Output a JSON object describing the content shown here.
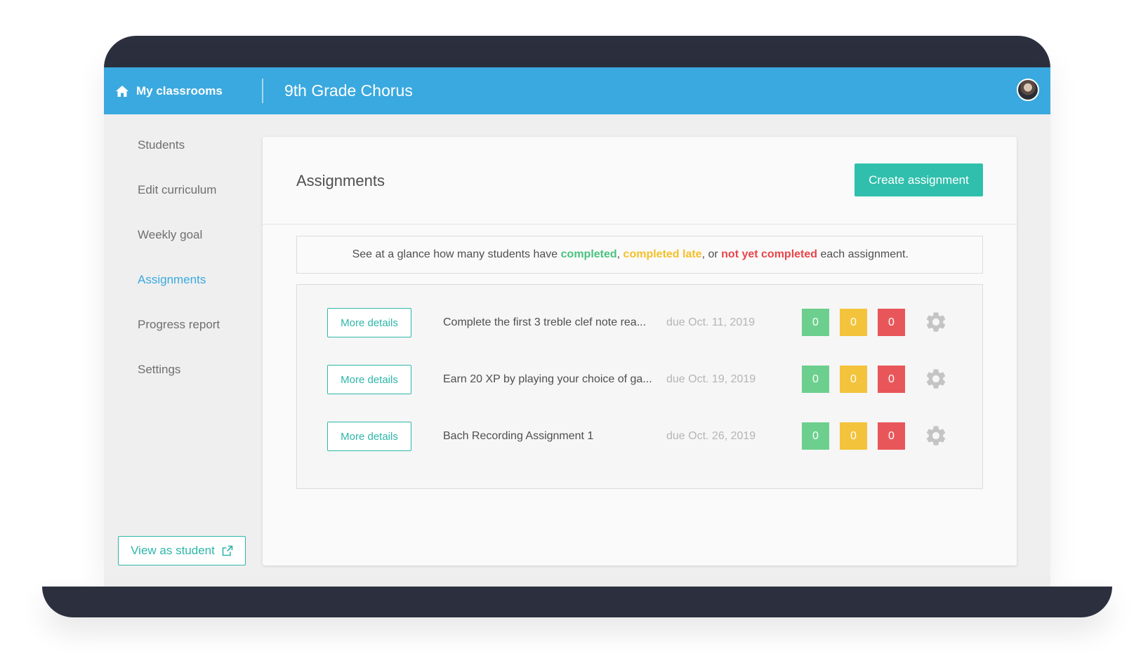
{
  "header": {
    "home_label": "My classrooms",
    "class_title": "9th Grade Chorus"
  },
  "sidebar": {
    "items": [
      {
        "label": "Students",
        "active": false
      },
      {
        "label": "Edit curriculum",
        "active": false
      },
      {
        "label": "Weekly goal",
        "active": false
      },
      {
        "label": "Assignments",
        "active": true
      },
      {
        "label": "Progress report",
        "active": false
      },
      {
        "label": "Settings",
        "active": false
      }
    ],
    "view_as_student_label": "View as student"
  },
  "main": {
    "title": "Assignments",
    "create_button_label": "Create assignment",
    "info": {
      "prefix": "See at a glance how many students have ",
      "completed": "completed",
      "sep1": ", ",
      "completed_late": "completed late",
      "sep2": ", or ",
      "not_completed": "not yet completed",
      "suffix": " each assignment."
    },
    "assignments": [
      {
        "details_label": "More details",
        "title": "Complete the first 3 treble clef note rea...",
        "due": "due Oct. 11, 2019",
        "completed": "0",
        "late": "0",
        "not_completed": "0"
      },
      {
        "details_label": "More details",
        "title": "Earn 20 XP by playing your choice of ga...",
        "due": "due Oct. 19, 2019",
        "completed": "0",
        "late": "0",
        "not_completed": "0"
      },
      {
        "details_label": "More details",
        "title": "Bach Recording Assignment 1",
        "due": "due Oct. 26, 2019",
        "completed": "0",
        "late": "0",
        "not_completed": "0"
      }
    ]
  },
  "colors": {
    "header_blue": "#3aa9df",
    "teal": "#2eb6a9",
    "green": "#6ccf8e",
    "yellow": "#f3c33b",
    "red": "#e9565a",
    "frame": "#2c303e"
  },
  "icons": {
    "home": "home-icon",
    "external_link": "external-link-icon",
    "settings": "gear-icon"
  }
}
